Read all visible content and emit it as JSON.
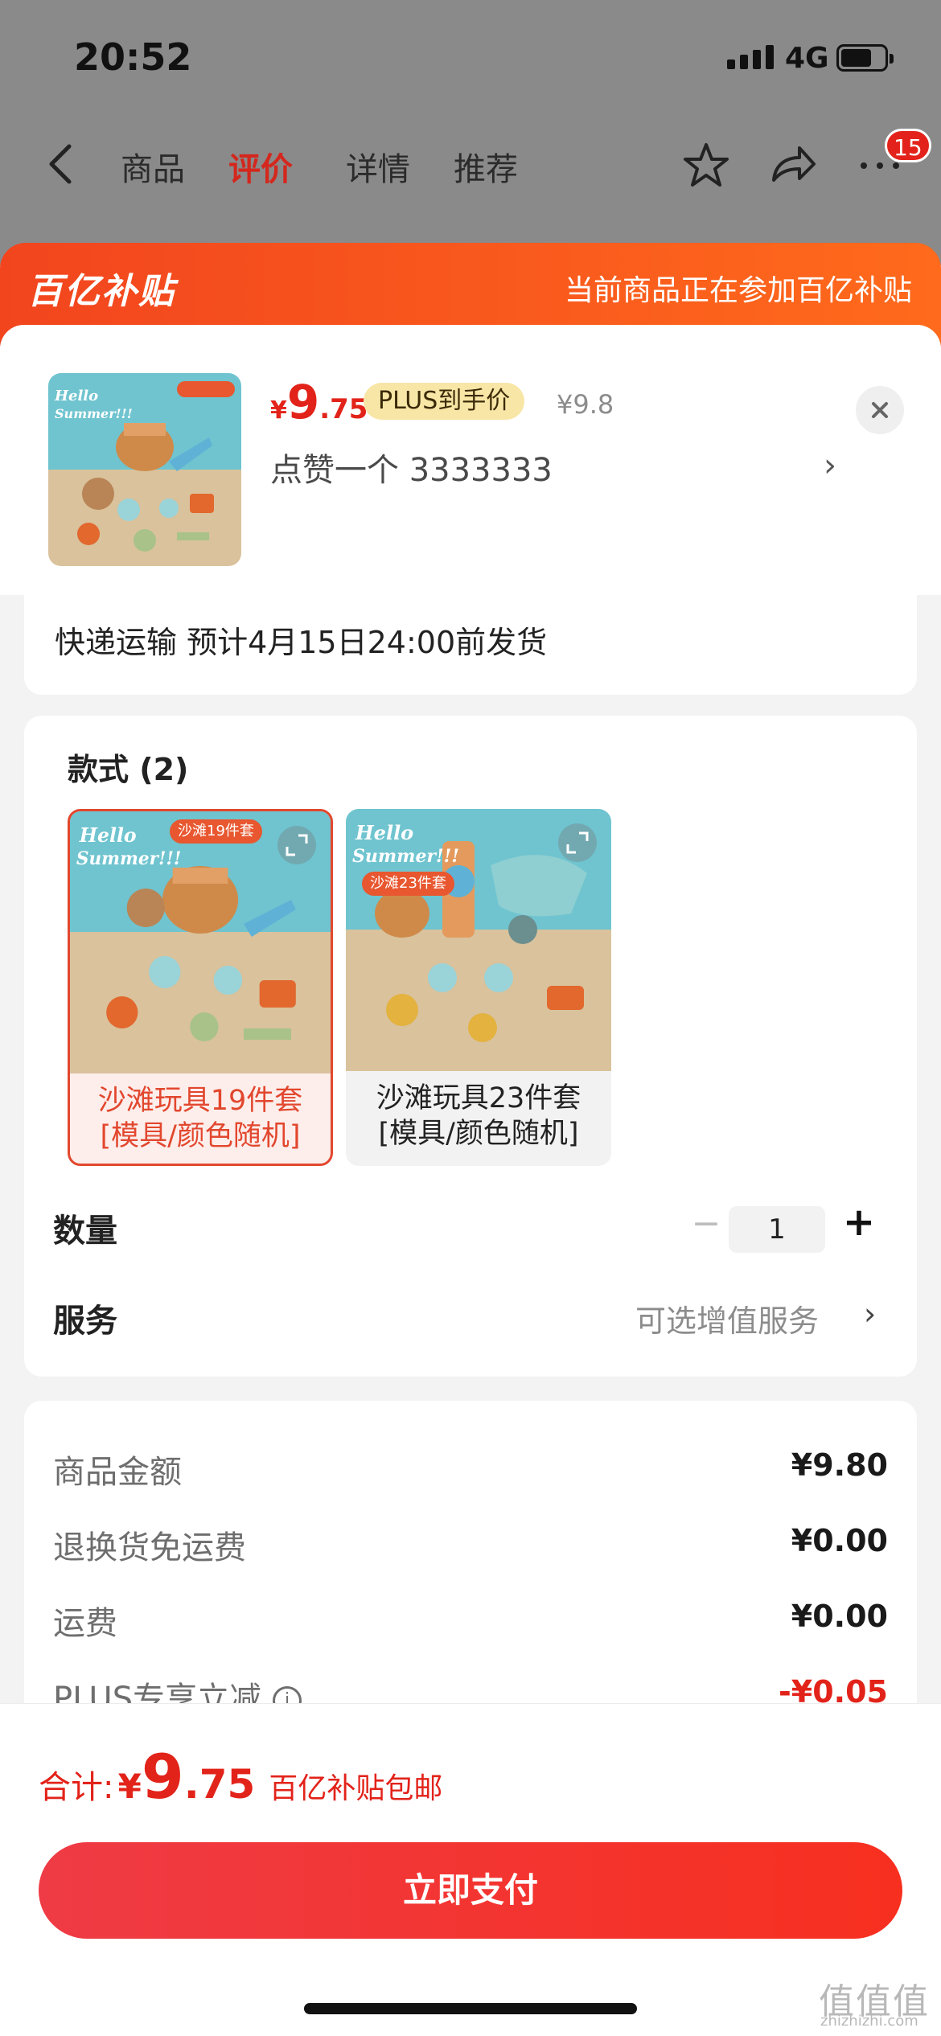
{
  "status_bar": {
    "time": "20:52",
    "network": "4G"
  },
  "nav": {
    "tabs": [
      {
        "label": "商品"
      },
      {
        "label": "评价"
      },
      {
        "label": "详情"
      },
      {
        "label": "推荐"
      }
    ],
    "active_tab": "评价",
    "badge": "15"
  },
  "subsidy_banner": {
    "logo": "百亿补贴",
    "note": "当前商品正在参加百亿补贴"
  },
  "product": {
    "price_symbol": "¥",
    "price_int": "9",
    "price_dec": ".75",
    "plus_tag": "PLUS到手价",
    "original_price": "¥9.8",
    "note": "点赞一个  3333333"
  },
  "shipping": {
    "text": "快递运输 预计4月15日24:00前发货"
  },
  "options": {
    "title": "款式 (2)",
    "variants": [
      {
        "label": "沙滩玩具19件套 [模具/颜色随机]",
        "line1": "沙滩玩具19件套",
        "line2": "[模具/颜色随机]",
        "selected": true,
        "img_tag": "沙滩19件套"
      },
      {
        "label": "沙滩玩具23件套 [模具/颜色随机]",
        "line1": "沙滩玩具23件套",
        "line2": "[模具/颜色随机]",
        "selected": false,
        "img_tag": "沙滩23件套"
      }
    ]
  },
  "quantity": {
    "label": "数量",
    "value": "1",
    "minus": "−",
    "plus": "+"
  },
  "service": {
    "label": "服务",
    "value": "可选增值服务",
    "chevron": "›"
  },
  "fees": [
    {
      "label": "商品金额",
      "value": "¥9.80"
    },
    {
      "label": "退换货免运费",
      "value": "¥0.00"
    },
    {
      "label": "运费",
      "value": "¥0.00"
    },
    {
      "label": "PLUS专享立减",
      "value": "-¥0.05"
    }
  ],
  "footer": {
    "total_label": "合计:",
    "total_symbol": "¥",
    "total_int": "9",
    "total_dec": ".75",
    "total_tag": "百亿补贴包邮",
    "pay_button": "立即支付"
  },
  "watermark": {
    "main": "值值值",
    "sub": "zhizhizhi.com"
  },
  "colors": {
    "accent_red": "#e2231a",
    "banner_orange": "#f2451e",
    "plus_gold": "#f8e6a6"
  }
}
